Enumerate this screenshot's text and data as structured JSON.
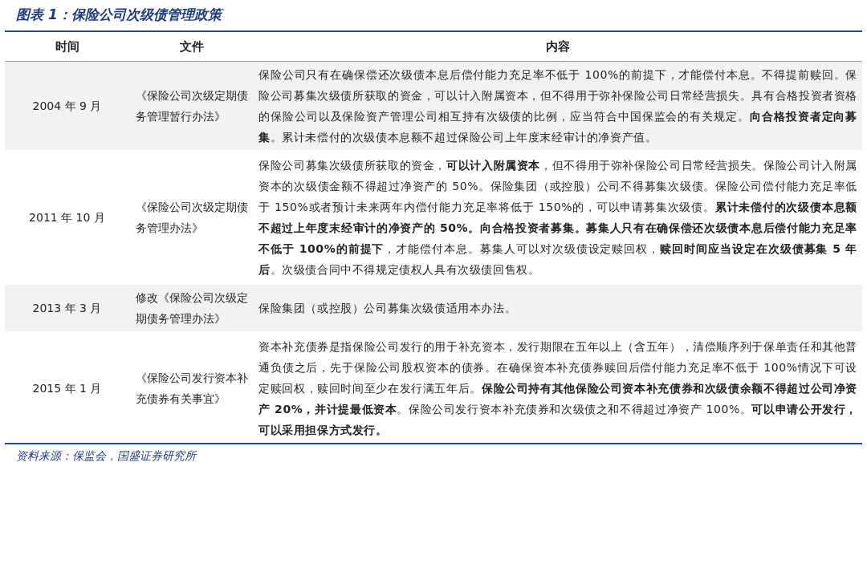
{
  "figure": {
    "title": "图表 1：保险公司次级债管理政策"
  },
  "table": {
    "columns": [
      "时间",
      "文件",
      "内容"
    ],
    "rows": [
      {
        "time": "2004 年 9 月",
        "document": "《保险公司次级定期债务管理暂行办法》",
        "content": "保险公司只有在确保偿还次级债本息后偿付能力充足率不低于 100%的前提下，才能偿付本息。不得提前赎回。保险公司募集次级债所获取的资金，可以计入附属资本，但不得用于弥补保险公司日常经营损失。具有合格投资者资格的保险公司以及保险资产管理公司相互持有次级债的比例，应当符合中国保监会的有关规定。**向合格投资者定向募集**。累计未偿付的次级债本息额不超过保险公司上年度末经审计的净资产值。"
      },
      {
        "time": "2011 年 10 月",
        "document": "《保险公司次级定期债务管理办法》",
        "content": "保险公司募集次级债所获取的资金，**可以计入附属资本**，但不得用于弥补保险公司日常经营损失。保险公司计入附属资本的次级债金额不得超过净资产的 50%。保险集团（或控股）公司不得募集次级债。保险公司偿付能力充足率低于 150%或者预计未来两年内偿付能力充足率将低于 150%的，可以申请募集次级债。**累计未偿付的次级债本息额不超过上年度末经审计的净资产的 50%。向合格投资者募集。募集人只有在确保偿还次级债本息后偿付能力充足率不低于 100%的前提下**，才能偿付本息。募集人可以对次级债设定赎回权，**赎回时间应当设定在次级债募集 5 年后**。次级债合同中不得规定债权人具有次级债回售权。"
      },
      {
        "time": "2013 年 3 月",
        "document": "修改《保险公司次级定期债务管理办法》",
        "content": "保险集团（或控股）公司募集次级债适用本办法。"
      },
      {
        "time": "2015 年 1 月",
        "document": "《保险公司发行资本补充债券有关事宜》",
        "content": "资本补充债券是指保险公司发行的用于补充资本，发行期限在五年以上（含五年），清偿顺序列于保单责任和其他普通负债之后，先于保险公司股权资本的债券。在确保资本补充债券赎回后偿付能力充足率不低于 100%情况下可设定赎回权，赎回时间至少在发行满五年后。**保险公司持有其他保险公司资本补充债券和次级债余额不得超过公司净资产 20%，并计提最低资本**。保险公司发行资本补充债券和次级债之和不得超过净资产 100%。**可以申请公开发行，可以采用担保方式发行。**"
      }
    ]
  },
  "source": "资料来源：保监会，国盛证券研究所"
}
